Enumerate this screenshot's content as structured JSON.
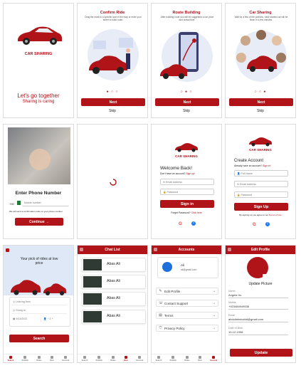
{
  "colors": {
    "brand": "#b01419",
    "background": "#ffffff",
    "border": "#dcdcdc"
  },
  "splash": {
    "brand": "CAR SHARING",
    "headline": "Let's go together",
    "tagline": "Sharing is caring"
  },
  "onboarding": [
    {
      "title": "Confirm Ride",
      "text": "Drag the mark to a specific spot in the map or enter your street to build route.",
      "next": "Next",
      "skip": "Skip"
    },
    {
      "title": "Route Building",
      "text": "After building route you will be suggested a car, price and arrival time.",
      "next": "Next",
      "skip": "Skip"
    },
    {
      "title": "Car Sharing",
      "text": "Wait for a few of the portions, have started car will be flown in a few minutes.",
      "next": "Next",
      "skip": "Skip"
    }
  ],
  "phone": {
    "title": "Enter Phone Number",
    "code": "+92",
    "placeholder": "Mobile number",
    "note": "We will send a confirmation code on your phone number",
    "button": "Continue"
  },
  "login": {
    "brand": "CAR SHARING",
    "title": "Welcome Back!",
    "prompt": "Don't have an account?",
    "signup": "Sign up!",
    "email": "Email Address",
    "password": "Password",
    "button": "Sign in",
    "forgot": "Forget Password?",
    "click": "Click here"
  },
  "register": {
    "brand": "CAR SHARING",
    "title": "Create Account",
    "prompt": "Already have an account?",
    "signin": "Sign in!",
    "name": "Full Name",
    "email": "Email Address",
    "password": "Password",
    "button": "Sign Up",
    "terms": "By signing up you agree to our",
    "terms_link": "Terms of Use"
  },
  "search": {
    "title": "Your pick of rides at low price",
    "from": "Leaving from",
    "to": "Going to",
    "date": "9/13/2022",
    "seats": "1",
    "button": "Search"
  },
  "nav": [
    "Search",
    "Publish",
    "Rides",
    "Chat",
    "Account"
  ],
  "chat": {
    "title": "Chat List",
    "items": [
      "Abas Ali",
      "Abas Ali",
      "Abas Ali",
      "Abas Ali"
    ]
  },
  "accounts": {
    "title": "Accounts",
    "name": "Ali",
    "email": "ali@gmail.com",
    "items": [
      "Edit Profile",
      "Contact Support",
      "Terms",
      "Privacy Policy"
    ]
  },
  "profile": {
    "title": "Edit Profile",
    "update": "Update Picture",
    "fields": [
      {
        "label": "Name",
        "value": "Angela Vu"
      },
      {
        "label": "Mobile",
        "value": "+923484949538"
      },
      {
        "label": "Email",
        "value": "abdullahshahid@gmail.com"
      },
      {
        "label": "Date of Birth",
        "value": "10-12-1998"
      }
    ],
    "button": "Update"
  }
}
